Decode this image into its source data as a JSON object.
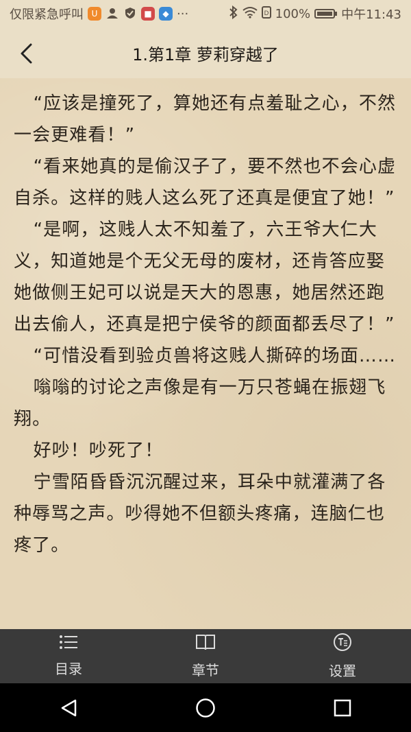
{
  "status_bar": {
    "emergency_text": "仅限紧急呼叫",
    "more": "···",
    "battery_text": "100%",
    "time": "中午11:43"
  },
  "header": {
    "title": "1.第1章 萝莉穿越了"
  },
  "content": {
    "paragraphs": [
      "“应该是撞死了，算她还有点羞耻之心，不然一会更难看！”",
      "“看来她真的是偷汉子了，要不然也不会心虚自杀。这样的贱人这么死了还真是便宜了她！”",
      "“是啊，这贱人太不知羞了，六王爷大仁大义，知道她是个无父无母的废材，还肯答应娶她做侧王妃可以说是天大的恩惠，她居然还跑出去偷人，还真是把宁侯爷的颜面都丢尽了！”",
      "“可惜没看到验贞兽将这贱人撕碎的场面……",
      "嗡嗡的讨论之声像是有一万只苍蝇在振翅飞翔。",
      "好吵！吵死了！",
      "宁雪陌昏昏沉沉醒过来，耳朵中就灌满了各种辱骂之声。吵得她不但额头疼痛，连脑仁也疼了。"
    ]
  },
  "bottom_bar": {
    "items": [
      {
        "label": "目录",
        "icon": "list-icon"
      },
      {
        "label": "章节",
        "icon": "book-icon"
      },
      {
        "label": "设置",
        "icon": "text-settings-icon"
      }
    ]
  },
  "nav_bar": {
    "icons": [
      "back-triangle-icon",
      "home-circle-icon",
      "recent-square-icon"
    ]
  },
  "colors": {
    "header_bg": "#eadfc7",
    "paper_bg": "#e6d6b8",
    "text": "#2b241c",
    "bottom_bar_bg": "#3a3a3a",
    "bottom_bar_text": "#dcdcdc"
  }
}
